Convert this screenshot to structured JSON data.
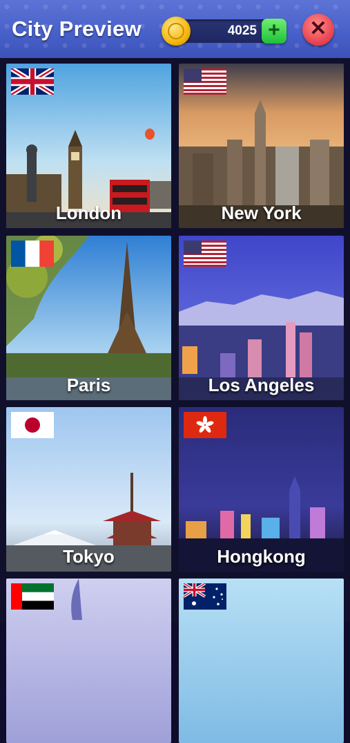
{
  "header": {
    "title": "City Preview",
    "coins": "4025",
    "plus_label": "+",
    "close_label": "✕"
  },
  "cities": [
    {
      "name": "London",
      "flag": "uk-flag-icon"
    },
    {
      "name": "New York",
      "flag": "us-flag-icon"
    },
    {
      "name": "Paris",
      "flag": "france-flag-icon"
    },
    {
      "name": "Los Angeles",
      "flag": "us-flag-icon"
    },
    {
      "name": "Tokyo",
      "flag": "japan-flag-icon"
    },
    {
      "name": "Hongkong",
      "flag": "hongkong-flag-icon"
    },
    {
      "name": "",
      "flag": "uae-flag-icon"
    },
    {
      "name": "",
      "flag": "australia-flag-icon"
    }
  ]
}
